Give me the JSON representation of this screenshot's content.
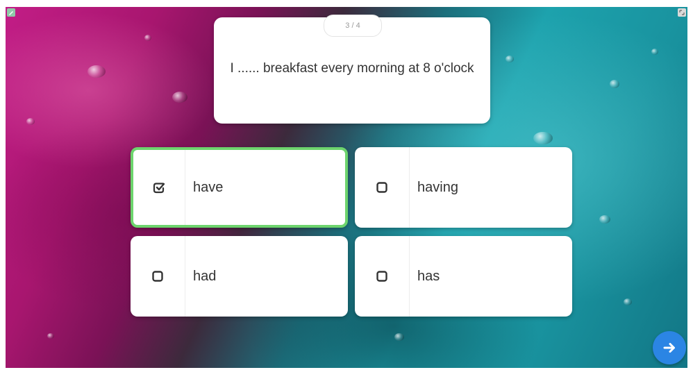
{
  "quiz": {
    "counter": "3 / 4",
    "question": "I ...... breakfast every morning at 8 o'clock",
    "options": [
      {
        "label": "have",
        "selected": true
      },
      {
        "label": "having",
        "selected": false
      },
      {
        "label": "had",
        "selected": false
      },
      {
        "label": "has",
        "selected": false
      }
    ],
    "selected_color": "#6dd46d",
    "next_icon": "arrow-right-icon",
    "next_color": "#2b85e4"
  }
}
